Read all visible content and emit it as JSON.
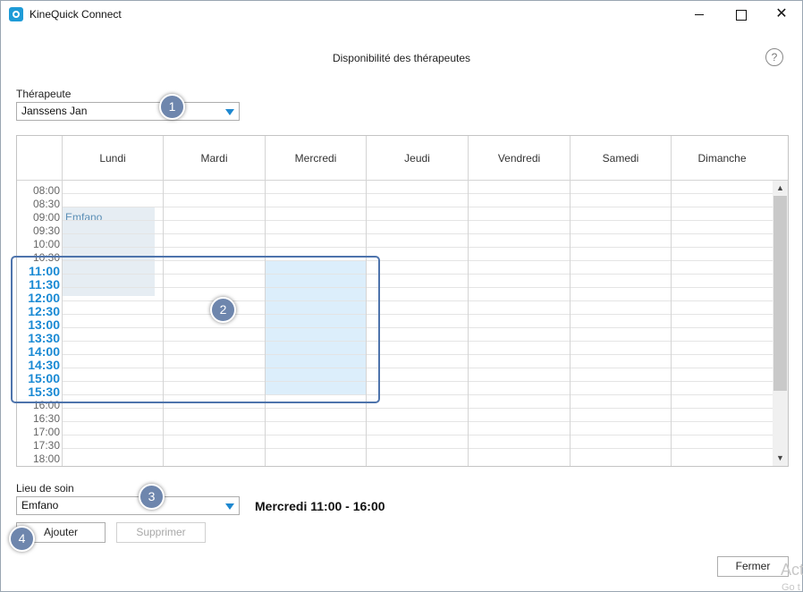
{
  "window": {
    "app_title": "KineQuick Connect",
    "minimize_label": "",
    "maximize_label": "",
    "close_label": "✕"
  },
  "dialog": {
    "title": "Disponibilité des thérapeutes",
    "help_label": "?"
  },
  "therapist": {
    "label": "Thérapeute",
    "value": "Janssens Jan"
  },
  "schedule": {
    "days": [
      "Lundi",
      "Mardi",
      "Mercredi",
      "Jeudi",
      "Vendredi",
      "Samedi",
      "Dimanche"
    ],
    "times": [
      "08:00",
      "08:30",
      "09:00",
      "09:30",
      "10:00",
      "10:30",
      "11:00",
      "11:30",
      "12:00",
      "12:30",
      "13:00",
      "13:30",
      "14:00",
      "14:30",
      "15:00",
      "15:30",
      "16:00",
      "16:30",
      "17:00",
      "17:30",
      "18:00"
    ],
    "highlighted_times": [
      "11:00",
      "11:30",
      "12:00",
      "12:30",
      "13:00",
      "13:30",
      "14:00",
      "14:30",
      "15:00",
      "15:30"
    ],
    "existing_block": {
      "day": "Lundi",
      "start": "09:00",
      "end": "12:00",
      "label": "Emfano"
    },
    "selected_block": {
      "day": "Mercredi",
      "start": "11:00",
      "end": "16:00"
    }
  },
  "location": {
    "label": "Lieu de soin",
    "value": "Emfano",
    "selection_summary": "Mercredi 11:00 - 16:00"
  },
  "buttons": {
    "add": "Ajouter",
    "delete": "Supprimer",
    "close": "Fermer"
  },
  "callouts": [
    "1",
    "2",
    "3",
    "4"
  ],
  "watermark": {
    "line1": "Act",
    "line2": "Go t"
  },
  "colors": {
    "accent": "#1a8ad4",
    "selection_fill": "#dceefb",
    "existing_fill": "#e6edf3",
    "callout_badge": "#6e86ad",
    "frame": "#4e74ac"
  }
}
